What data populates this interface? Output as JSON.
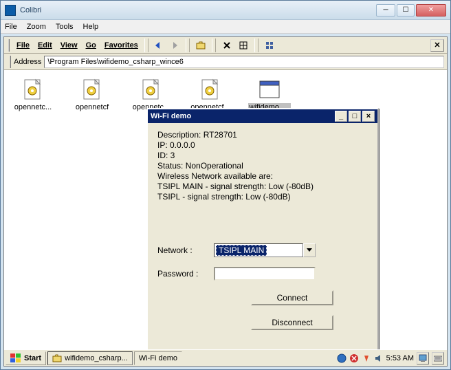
{
  "outer": {
    "title": "Colibri",
    "menu": {
      "file": "File",
      "zoom": "Zoom",
      "tools": "Tools",
      "help": "Help"
    }
  },
  "ce_menu": {
    "file": "File",
    "edit": "Edit",
    "view": "View",
    "go": "Go",
    "favorites": "Favorites"
  },
  "address": {
    "label": "Address",
    "value": "\\Program Files\\wifidemo_csharp_wince6"
  },
  "files": {
    "items": [
      {
        "label": "opennetc...",
        "type": "dll"
      },
      {
        "label": "opennetcf",
        "type": "dll"
      },
      {
        "label": "opennetc...",
        "type": "dll"
      },
      {
        "label": "opennetcf...",
        "type": "dll"
      },
      {
        "label": "wifidemo_...",
        "type": "exe"
      }
    ]
  },
  "wifi": {
    "title": "Wi-Fi demo",
    "desc": "Description: RT28701",
    "ip": "IP: 0.0.0.0",
    "id": "ID: 3",
    "status": "Status: NonOperational",
    "avail": "Wireless Network available are:",
    "net1": "TSIPL MAIN -  signal strength: Low (-80dB)",
    "net2": "TSIPL -  signal strength: Low (-80dB)",
    "network_label": "Network  :",
    "network_value": "TSIPL MAIN",
    "password_label": "Password  :",
    "password_value": "",
    "connect": "Connect",
    "disconnect": "Disconnect"
  },
  "taskbar": {
    "start": "Start",
    "task1": "wifidemo_csharp...",
    "task2": "Wi-Fi demo",
    "time": "5:53 AM"
  }
}
